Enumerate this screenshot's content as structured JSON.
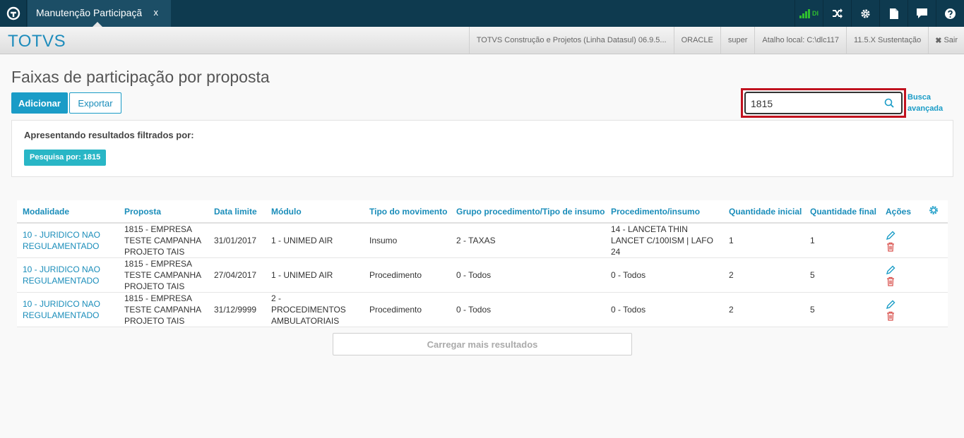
{
  "topbar": {
    "tab_title": "Manutenção Participação",
    "tab_close": "x",
    "signal_label": "DI"
  },
  "subbar": {
    "brand": "TOTVS",
    "items": [
      "TOTVS Construção e Projetos (Linha Datasul) 06.9.5...",
      "ORACLE",
      "super",
      "Atalho local: C:\\dlc117",
      "11.5.X Sustentação"
    ],
    "logout": "Sair"
  },
  "page": {
    "title": "Faixas de participação por proposta",
    "add_label": "Adicionar",
    "export_label": "Exportar"
  },
  "search": {
    "value": "1815",
    "advanced_label": "Busca avançada"
  },
  "filter": {
    "title": "Apresentando resultados filtrados por:",
    "chip": "Pesquisa por: 1815"
  },
  "table": {
    "headers": [
      "Modalidade",
      "Proposta",
      "Data limite",
      "Módulo",
      "Tipo do movimento",
      "Grupo procedimento/Tipo de insumo",
      "Procedimento/insumo",
      "Quantidade inicial",
      "Quantidade final",
      "Ações"
    ],
    "rows": [
      {
        "modalidade": "10 - JURIDICO NAO REGULAMENTADO",
        "proposta": "1815 - EMPRESA TESTE CAMPANHA PROJETO TAIS",
        "data": "31/01/2017",
        "modulo": "1 - UNIMED AIR",
        "tipo": "Insumo",
        "grupo": "2 - TAXAS",
        "proc": "14 - LANCETA THIN LANCET C/100ISM | LAFO 24",
        "qini": "1",
        "qfin": "1"
      },
      {
        "modalidade": "10 - JURIDICO NAO REGULAMENTADO",
        "proposta": "1815 - EMPRESA TESTE CAMPANHA PROJETO TAIS",
        "data": "27/04/2017",
        "modulo": "1 - UNIMED AIR",
        "tipo": "Procedimento",
        "grupo": "0 - Todos",
        "proc": "0 - Todos",
        "qini": "2",
        "qfin": "5"
      },
      {
        "modalidade": "10 - JURIDICO NAO REGULAMENTADO",
        "proposta": "1815 - EMPRESA TESTE CAMPANHA PROJETO TAIS",
        "data": "31/12/9999",
        "modulo": "2 - PROCEDIMENTOS AMBULATORIAIS",
        "tipo": "Procedimento",
        "grupo": "0 - Todos",
        "proc": "0 - Todos",
        "qini": "2",
        "qfin": "5"
      }
    ]
  },
  "load_more": "Carregar mais resultados",
  "colors": {
    "topbar": "#0e3a4f",
    "accent": "#1a9cc7",
    "chip": "#29b6c6",
    "highlight": "#c1121f",
    "delete": "#d9534f"
  }
}
